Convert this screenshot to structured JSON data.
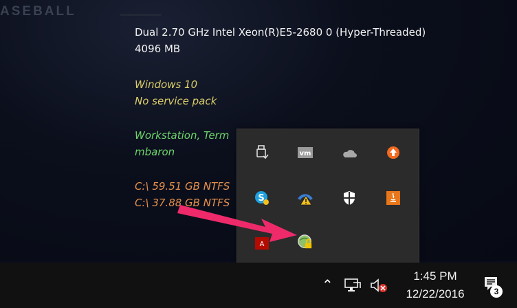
{
  "desktop": {
    "brand_text": "ASEBALL",
    "sysinfo": {
      "cpu": "Dual 2.70 GHz Intel Xeon(R)E5-2680 0 (Hyper-Threaded)",
      "memory": "4096 MB",
      "os": "Windows 10",
      "service_pack": "No service pack",
      "machine_type": "Workstation, Term",
      "user": "mbaron",
      "disk1": "C:\\ 59.51 GB NTFS",
      "disk2": "C:\\ 37.88 GB NTFS"
    }
  },
  "tray_popup": {
    "icons": [
      "usb-eject-icon",
      "vmware-icon",
      "onedrive-icon",
      "update-arrow-icon",
      "skype-icon",
      "network-warning-icon",
      "windows-defender-icon",
      "java-icon",
      "adobe-reader-icon",
      "vpn-lock-icon"
    ]
  },
  "taskbar": {
    "time": "1:45 PM",
    "date": "12/22/2016",
    "notification_count": "3"
  },
  "colors": {
    "popup_bg": "#2b2b2b",
    "taskbar_bg": "#111111",
    "arrow": "#ee2a6a"
  }
}
